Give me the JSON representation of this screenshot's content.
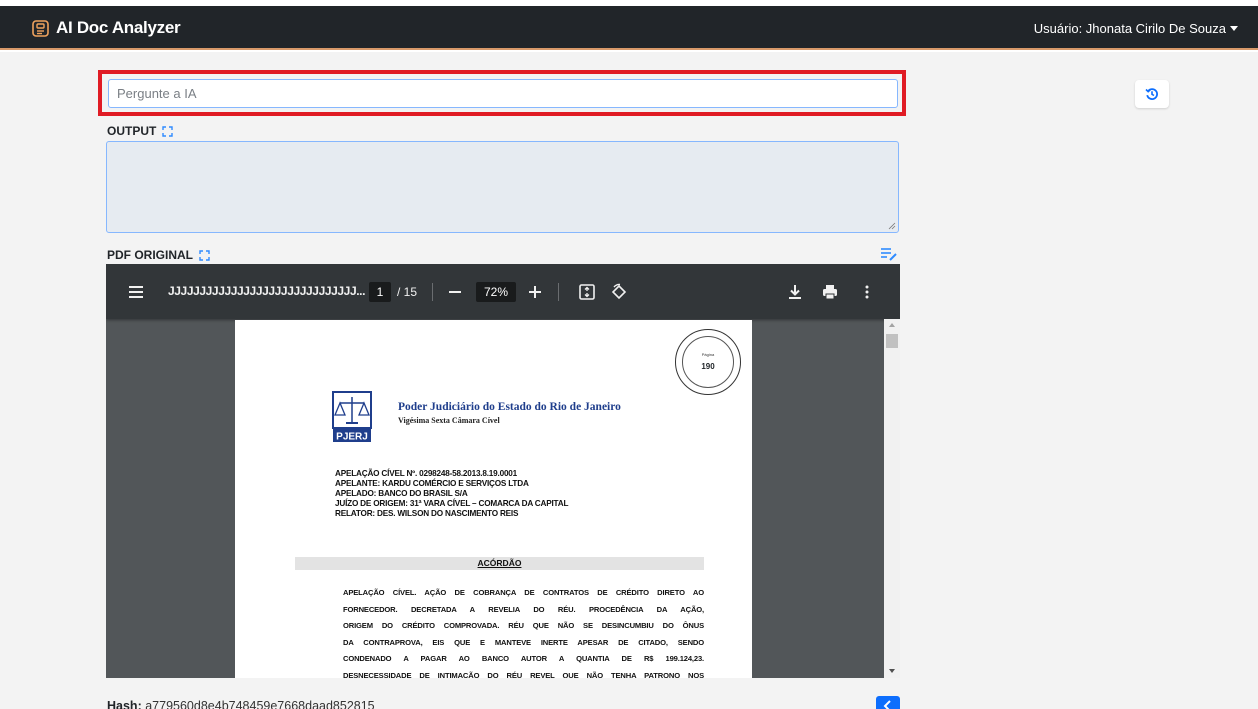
{
  "app": {
    "title": "AI Doc Analyzer",
    "user_label": "Usuário: Jhonata Cirilo De Souza"
  },
  "ask": {
    "placeholder": "Pergunte a IA",
    "value": ""
  },
  "output": {
    "label": "OUTPUT",
    "value": ""
  },
  "pdf": {
    "label": "PDF ORIGINAL",
    "toolbar": {
      "doc_title": "JJJJJJJJJJJJJJJJJJJJJJJJJJJJJJ...",
      "page_current": "1",
      "page_total": "/ 15",
      "zoom": "72%"
    },
    "page": {
      "stamp_text": "Página",
      "stamp_number": "190",
      "logo_text": "PJERJ",
      "court_name": "Poder Judiciário do Estado do Rio de Janeiro",
      "chamber": "Vigésima Sexta Câmara Cível",
      "case_lines": [
        "APELAÇÃO CÍVEL Nº. 0298248-58.2013.8.19.0001",
        "APELANTE: KARDU COMÉRCIO E SERVIÇOS LTDA",
        "APELADO: BANCO DO BRASIL S/A",
        "JUÍZO DE ORIGEM: 31ª VARA CÍVEL – COMARCA DA CAPITAL",
        "RELATOR: DES. WILSON DO NASCIMENTO REIS"
      ],
      "heading": "ACÓRDÃO",
      "body_lines": [
        "APELAÇÃO CÍVEL. AÇÃO DE COBRANÇA DE CONTRATOS DE CRÉDITO DIRETO AO",
        "FORNECEDOR. DECRETADA A REVELIA DO RÉU. PROCEDÊNCIA DA AÇÃO,",
        "ORIGEM DO CRÉDITO COMPROVADA. RÉU QUE NÃO SE DESINCUMBIU DO ÔNUS",
        "DA CONTRAPROVA, EIS QUE E MANTEVE INERTE APESAR DE CITADO, SENDO",
        "CONDENADO A PAGAR AO BANCO AUTOR A QUANTIA DE R$ 199.124,23.",
        "DESNECESSIDADE DE INTIMAÇÃO DO RÉU REVEL QUE NÃO TENHA PATRONO NOS"
      ]
    }
  },
  "footer": {
    "hash_label": "Hash:",
    "hash_value": "a779560d8e4b748459e7668daad852815"
  },
  "colors": {
    "navbar": "#212529",
    "accent_blue": "#0d6efd",
    "highlight_red": "#e01b24",
    "court_blue": "#1f3e8c"
  },
  "icons": [
    "app-logo-icon",
    "history-icon",
    "expand-icon",
    "notes-edit-icon",
    "menu-icon",
    "fit-page-icon",
    "rotate-icon",
    "download-icon",
    "print-icon",
    "more-icon",
    "send-icon"
  ]
}
